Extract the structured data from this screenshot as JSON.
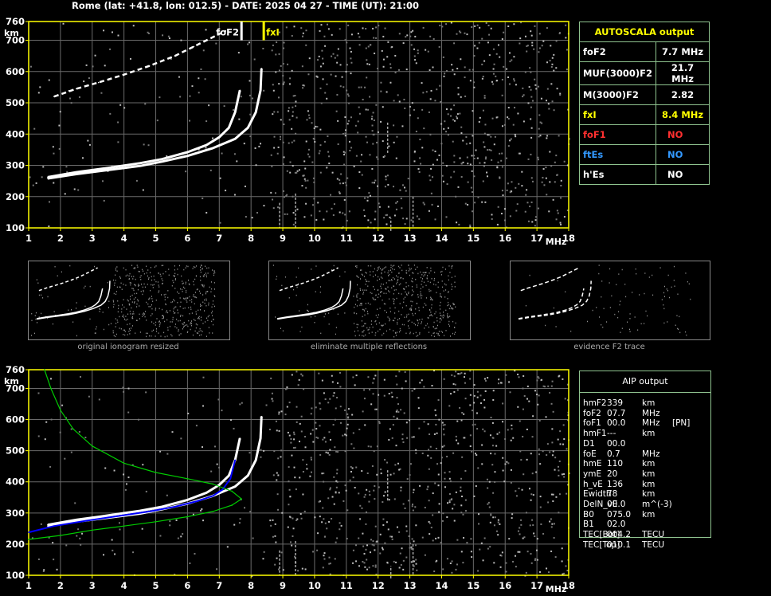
{
  "header": "Rome (lat: +41.8, lon: 012.5) - DATE: 2025 04 27 - TIME (UT): 21:00",
  "colors": {
    "axis": "#ffff00",
    "grid": "#6a6a6a",
    "trace": "#ffffff",
    "profile": "#00cc00",
    "blue_trace": "#0000ff",
    "fof2": "#ffffff",
    "fxi": "#ffff00",
    "fof1": "#ff3030",
    "ftes": "#3399ff",
    "table_border": "#8fc38f"
  },
  "axes": {
    "y_ticks": [
      "760",
      "700",
      "600",
      "500",
      "400",
      "300",
      "200",
      "100"
    ],
    "x_ticks": [
      "1",
      "2",
      "3",
      "4",
      "5",
      "6",
      "7",
      "8",
      "9",
      "10",
      "11",
      "12",
      "13",
      "14",
      "15",
      "16",
      "17",
      "18"
    ],
    "y_unit": "km",
    "x_unit": "MHz"
  },
  "markers": {
    "fof2_label": "foF2",
    "fxi_label": "fxI"
  },
  "chart_data": [
    {
      "type": "scatter",
      "title": "",
      "xlabel": "MHz",
      "ylabel": "km",
      "xlim": [
        1,
        18
      ],
      "ylim": [
        100,
        760
      ],
      "grid": true,
      "series": [
        {
          "x": [
            1.6,
            2.5,
            3.5,
            4.5,
            5.2,
            6.0,
            6.6,
            7.0,
            7.3,
            7.5,
            7.65
          ],
          "y": [
            262,
            278,
            292,
            307,
            320,
            342,
            365,
            390,
            420,
            470,
            540
          ]
        },
        {
          "x": [
            1.6,
            2.5,
            3.5,
            4.5,
            5.2,
            6.0,
            6.8,
            7.5,
            7.9,
            8.15,
            8.3,
            8.33
          ],
          "y": [
            258,
            272,
            285,
            298,
            312,
            330,
            355,
            385,
            420,
            470,
            540,
            610
          ]
        },
        {
          "x": [
            1.8,
            2.5,
            3.2,
            4.0,
            4.8,
            5.6,
            6.2,
            6.8,
            7.2
          ],
          "y": [
            520,
            545,
            565,
            590,
            618,
            650,
            680,
            710,
            730
          ]
        }
      ],
      "markers": [
        {
          "name": "foF2",
          "x": 7.7
        },
        {
          "name": "fxI",
          "x": 8.4
        }
      ]
    },
    {
      "type": "line",
      "title": "",
      "xlabel": "MHz",
      "ylabel": "km",
      "xlim": [
        1,
        18
      ],
      "ylim": [
        100,
        760
      ],
      "grid": true,
      "series": [
        {
          "x": [
            1.6,
            2.5,
            3.5,
            4.5,
            5.2,
            6.0,
            6.6,
            7.0,
            7.3,
            7.5,
            7.65
          ],
          "y": [
            262,
            278,
            292,
            307,
            320,
            342,
            365,
            390,
            420,
            470,
            540
          ]
        },
        {
          "x": [
            1.6,
            2.5,
            3.5,
            4.5,
            5.2,
            6.0,
            6.8,
            7.5,
            7.9,
            8.15,
            8.3,
            8.33
          ],
          "y": [
            258,
            272,
            285,
            298,
            312,
            330,
            355,
            385,
            420,
            470,
            540,
            610
          ]
        },
        {
          "x": [
            1.0,
            1.8,
            2.8,
            3.8,
            4.8,
            5.6,
            6.3,
            6.8,
            7.1,
            7.35,
            7.5
          ],
          "y": [
            238,
            258,
            275,
            290,
            305,
            320,
            338,
            355,
            375,
            410,
            470
          ]
        },
        {
          "x": [
            1.0,
            2.0,
            3.0,
            4.0,
            5.0,
            6.0,
            6.8,
            7.4,
            7.7,
            7.4,
            6.8,
            6.0,
            5.0,
            4.0,
            3.0,
            2.4,
            2.0,
            1.7,
            1.5
          ],
          "y": [
            215,
            228,
            245,
            258,
            272,
            288,
            305,
            325,
            345,
            370,
            393,
            410,
            430,
            460,
            515,
            570,
            630,
            700,
            760
          ]
        }
      ]
    }
  ],
  "thumbnails": {
    "captions": [
      "original ionogram resized",
      "eliminate multiple reflections",
      "evidence F2 trace"
    ]
  },
  "autoscala": {
    "title": "AUTOSCALA output",
    "rows": [
      {
        "label": "foF2",
        "value": "7.7 MHz"
      },
      {
        "label": "MUF(3000)F2",
        "value": "21.7 MHz"
      },
      {
        "label": "M(3000)F2",
        "value": "2.82"
      },
      {
        "label": "fxI",
        "value": "8.4 MHz"
      },
      {
        "label": "foF1",
        "value": "NO"
      },
      {
        "label": "ftEs",
        "value": "NO"
      },
      {
        "label": "h'Es",
        "value": "NO"
      }
    ]
  },
  "aip": {
    "title": "AIP output",
    "rows": [
      {
        "name": "hmF2",
        "value": "339",
        "unit": "km",
        "extra": ""
      },
      {
        "name": "foF2",
        "value": "07.7",
        "unit": "MHz",
        "extra": ""
      },
      {
        "name": "foF1",
        "value": "00.0",
        "unit": "MHz",
        "extra": "[PN]"
      },
      {
        "name": "hmF1",
        "value": "---",
        "unit": "km",
        "extra": ""
      },
      {
        "name": "D1",
        "value": "00.0",
        "unit": "",
        "extra": ""
      },
      {
        "name": "foE",
        "value": "0.7",
        "unit": "MHz",
        "extra": ""
      },
      {
        "name": "hmE",
        "value": "110",
        "unit": "km",
        "extra": ""
      },
      {
        "name": "ymE",
        "value": "20",
        "unit": "km",
        "extra": ""
      },
      {
        "name": "h_vE",
        "value": "136",
        "unit": "km",
        "extra": ""
      },
      {
        "name": "Ewidth",
        "value": "78",
        "unit": "km",
        "extra": ""
      },
      {
        "name": "DelN_vE",
        "value": "00.0",
        "unit": "m^(-3)",
        "extra": ""
      },
      {
        "name": "B0",
        "value": "075.0",
        "unit": "km",
        "extra": ""
      },
      {
        "name": "B1",
        "value": "02.0",
        "unit": "",
        "extra": ""
      },
      {
        "name": "TEC[Bot]",
        "value": "004.2",
        "unit": "TECU",
        "extra": ""
      },
      {
        "name": "TEC[Top]",
        "value": "010.1",
        "unit": "TECU",
        "extra": ""
      }
    ]
  }
}
